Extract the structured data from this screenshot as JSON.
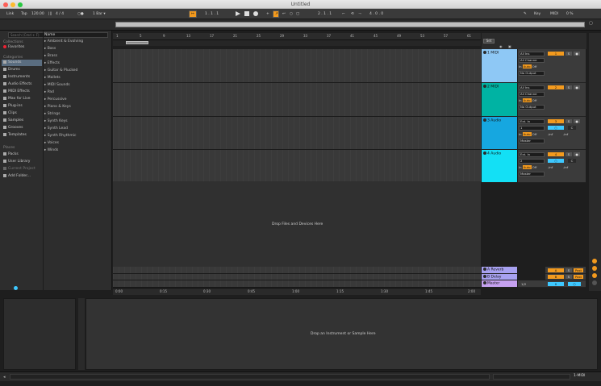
{
  "window": {
    "title": "Untitled"
  },
  "transport": {
    "link": "Link",
    "tap": "Tap",
    "tempo": "120.00",
    "bars_icon": "|||",
    "signature": "4 / 4",
    "metro": "○●",
    "quant": "1 Bar ▾",
    "follow": "↦",
    "position": "1 .  1 .  1",
    "overdub": "+",
    "loop_start": "2 .  1 .  1",
    "loop_len": "4 .  0 .  0",
    "key": "Key",
    "midi": "MIDI",
    "cpu": "0 %"
  },
  "browser": {
    "search_placeholder": "Search (Cmd + F)",
    "collections_head": "Collections",
    "favorites": "Favorites",
    "categories_head": "Categories",
    "categories": [
      "Sounds",
      "Drums",
      "Instruments",
      "Audio Effects",
      "MIDI Effects",
      "Max for Live",
      "Plug-ins",
      "Clips",
      "Samples",
      "Grooves",
      "Templates"
    ],
    "places_head": "Places",
    "places": [
      "Packs",
      "User Library",
      "Current Project",
      "Add Folder..."
    ],
    "name_head": "Name",
    "names": [
      "Ambient & Evolving",
      "Bass",
      "Brass",
      "Effects",
      "Guitar & Plucked",
      "Mallets",
      "MIDI Sounds",
      "Pad",
      "Percussive",
      "Piano & Keys",
      "Strings",
      "Synth Keys",
      "Synth Lead",
      "Synth Rhythmic",
      "Voices",
      "Winds"
    ]
  },
  "arrangement": {
    "bar_ticks": [
      "1",
      "5",
      "9",
      "13",
      "17",
      "21",
      "25",
      "29",
      "33",
      "37",
      "41",
      "45",
      "49",
      "53",
      "57",
      "61"
    ],
    "time_ticks": [
      "0:00",
      "0:15",
      "0:30",
      "0:45",
      "1:00",
      "1:15",
      "1:30",
      "1:45",
      "2:00"
    ],
    "drop_msg": "Drop Files and Devices Here",
    "set_label": "Set"
  },
  "tracks": [
    {
      "name": "1 MIDI",
      "color": "#8ec8f5",
      "input": "All Ins",
      "channel": "All Channe",
      "monitor": [
        "In",
        "Auto",
        "Off"
      ],
      "output": "No Output",
      "num": "1"
    },
    {
      "name": "2 MIDI",
      "color": "#00b3a3",
      "input": "All Ins",
      "channel": "All Channe",
      "monitor": [
        "In",
        "Auto",
        "Off"
      ],
      "output": "No Output",
      "num": "2"
    },
    {
      "name": "3 Audio",
      "color": "#16a7e0",
      "input": "Ext. In",
      "channel": "1",
      "monitor": [
        "In",
        "Auto",
        "Off"
      ],
      "output": "Master",
      "num": "3",
      "vol": "-inf",
      "pan": "-inf"
    },
    {
      "name": "4 Audio",
      "color": "#13e0f5",
      "input": "Ext. In",
      "channel": "2",
      "monitor": [
        "In",
        "Auto",
        "Off"
      ],
      "output": "Master",
      "num": "4",
      "vol": "-inf",
      "pan": "-inf"
    }
  ],
  "returns": [
    {
      "name": "A Reverb",
      "color": "#a7a1f0",
      "letter": "A",
      "post": "Post"
    },
    {
      "name": "B Delay",
      "color": "#a7a1f0",
      "letter": "B",
      "post": "Post"
    },
    {
      "name": "Master",
      "color": "#c6a1f0",
      "cue": "1/2",
      "letter": "0"
    }
  ],
  "detail": {
    "drop_msg": "Drop an Instrument or Sample Here",
    "status_right": "1-MIDI"
  },
  "colors": {
    "orange": "#f39a1e",
    "blue_btn": "#3ec8ff"
  }
}
